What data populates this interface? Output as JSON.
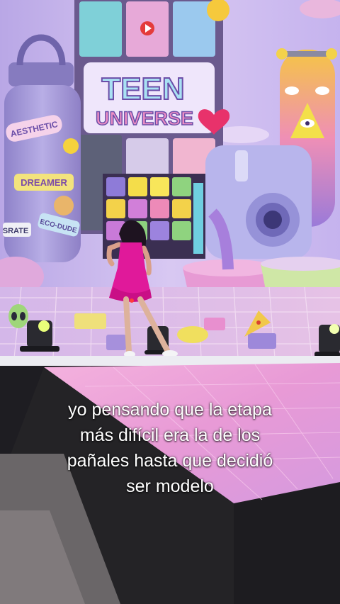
{
  "backdrop": {
    "sign_line1": "TEEN",
    "sign_line2": "UNIVERSE",
    "bottle_labels": [
      "AESTHETIC",
      "DREAMER",
      "ECO-DUDE",
      "SRATE"
    ]
  },
  "caption": {
    "lines": [
      "yo pensando que la etapa",
      "más difícil era la de los",
      "pañales hasta que decidió",
      "ser modelo"
    ]
  },
  "colors": {
    "backdrop_lavender": "#c8b6ec",
    "stage_floor": "#e4b9e6",
    "runway_pink": "#e9a3dc",
    "dress_magenta": "#e0199a",
    "runway_edge": "#1c1c1e"
  }
}
